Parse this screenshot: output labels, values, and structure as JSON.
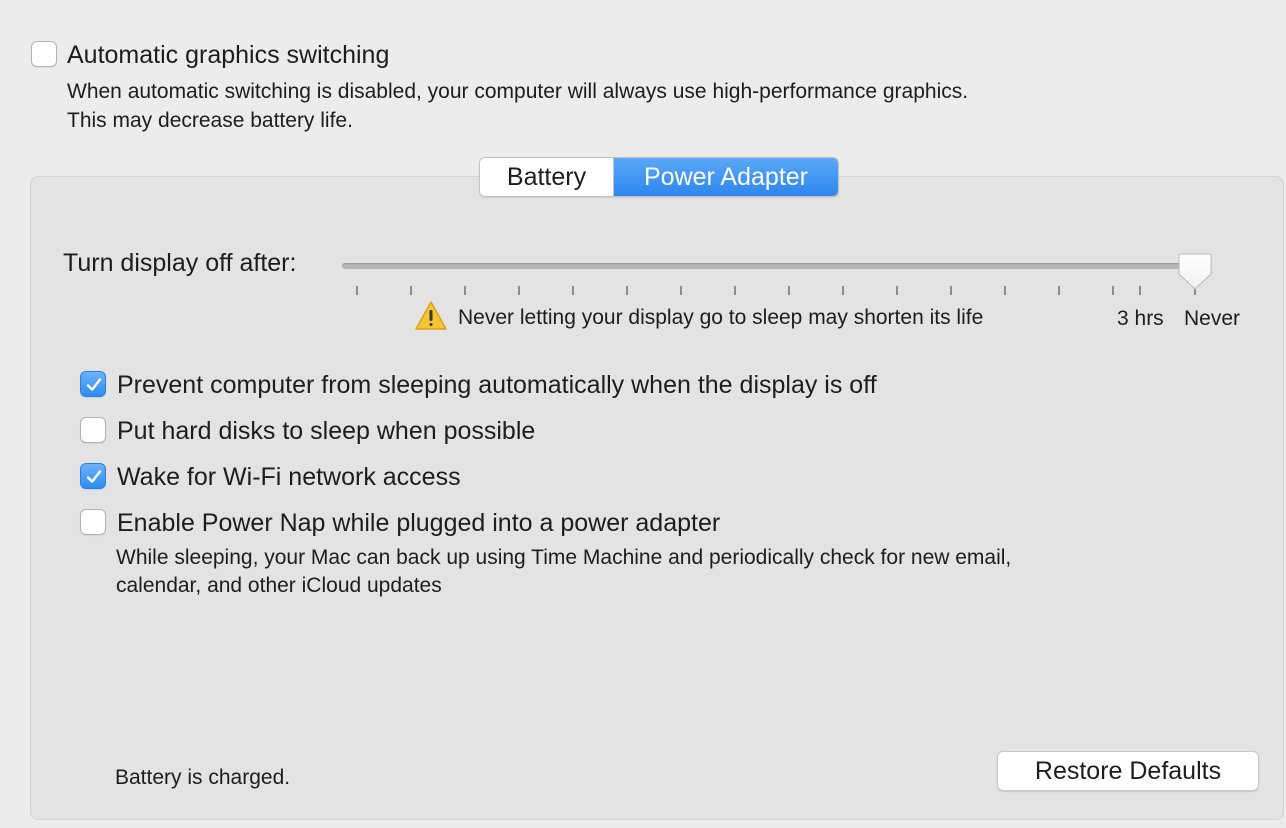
{
  "graphics": {
    "checkbox_label": "Automatic graphics switching",
    "checked": false,
    "description_line1": "When automatic switching is disabled, your computer will always use high-performance graphics.",
    "description_line2": "This may decrease battery life."
  },
  "tabs": [
    {
      "label": "Battery",
      "selected": false
    },
    {
      "label": "Power Adapter",
      "selected": true
    }
  ],
  "display_sleep": {
    "label": "Turn display off after:",
    "value": "Never",
    "slider_level": 1.0,
    "tick_labels": [
      "3 hrs",
      "Never"
    ],
    "warning": "Never letting your display go to sleep may shorten its life",
    "warning_icon": "warning-triangle-icon"
  },
  "options": [
    {
      "label": "Prevent computer from sleeping automatically when the display is off",
      "checked": true
    },
    {
      "label": "Put hard disks to sleep when possible",
      "checked": false
    },
    {
      "label": "Wake for Wi-Fi network access",
      "checked": true
    },
    {
      "label": "Enable Power Nap while plugged into a power adapter",
      "checked": false
    }
  ],
  "power_nap_description": {
    "line1": "While sleeping, your Mac can back up using Time Machine and periodically check for new email,",
    "line2": "calendar, and other iCloud updates"
  },
  "status_text": "Battery is charged.",
  "restore_button": "Restore Defaults",
  "colors": {
    "accent": "#2e86ee",
    "background": "#ececec",
    "panel": "#e3e3e3"
  }
}
